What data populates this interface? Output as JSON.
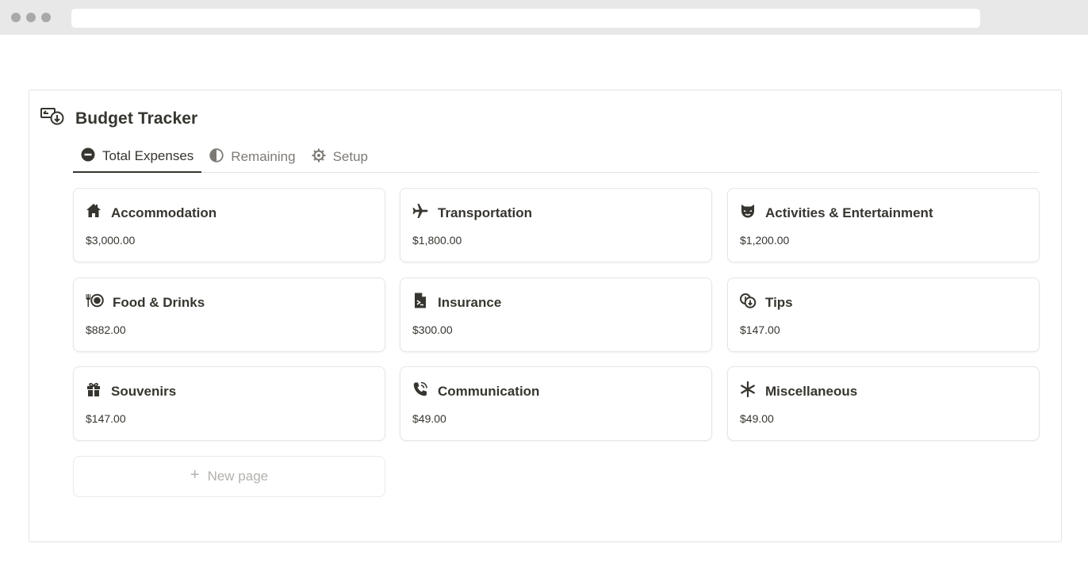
{
  "page": {
    "title": "Budget Tracker",
    "icon": "money-exchange-icon"
  },
  "tabs": [
    {
      "label": "Total Expenses",
      "icon": "minus-circle-icon",
      "active": true
    },
    {
      "label": "Remaining",
      "icon": "half-circle-icon",
      "active": false
    },
    {
      "label": "Setup",
      "icon": "gear-icon",
      "active": false
    }
  ],
  "cards": [
    {
      "name": "Accommodation",
      "amount": "$3,000.00",
      "icon": "house-icon"
    },
    {
      "name": "Transportation",
      "amount": "$1,800.00",
      "icon": "airplane-icon"
    },
    {
      "name": "Activities & Entertainment",
      "amount": "$1,200.00",
      "icon": "theater-mask-icon"
    },
    {
      "name": "Food & Drinks",
      "amount": "$882.00",
      "icon": "fork-plate-icon"
    },
    {
      "name": "Insurance",
      "amount": "$300.00",
      "icon": "document-icon"
    },
    {
      "name": "Tips",
      "amount": "$147.00",
      "icon": "coins-icon"
    },
    {
      "name": "Souvenirs",
      "amount": "$147.00",
      "icon": "gift-icon"
    },
    {
      "name": "Communication",
      "amount": "$49.00",
      "icon": "phone-icon"
    },
    {
      "name": "Miscellaneous",
      "amount": "$49.00",
      "icon": "asterisk-icon"
    }
  ],
  "new_page": {
    "label": "New page",
    "icon": "plus-icon"
  },
  "colors": {
    "text": "#37352f",
    "muted": "#7d7a75",
    "border": "#e7e6e3"
  }
}
